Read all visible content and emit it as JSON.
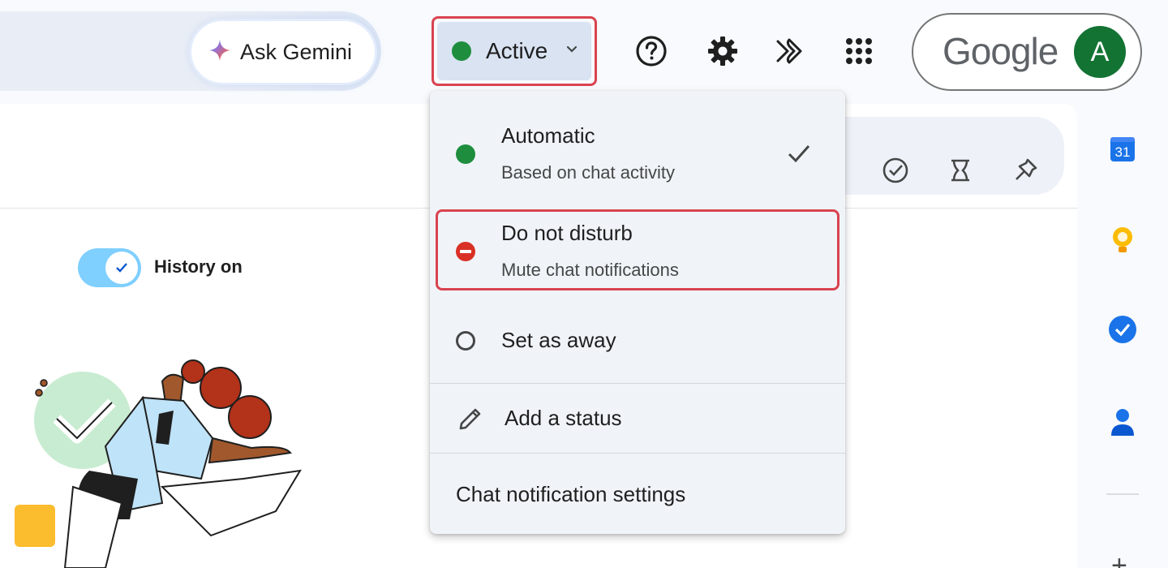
{
  "header": {
    "gemini_label": "Ask Gemini",
    "status_label": "Active",
    "status_color": "#1e8e3e",
    "icons": [
      "help-icon",
      "settings-gear-icon",
      "gemini-sparkle-icon",
      "apps-grid-icon"
    ],
    "brand": "Google",
    "avatar_letter": "A"
  },
  "toolbar": {
    "icons": [
      "task-check-icon",
      "snippet-icon",
      "pin-icon"
    ]
  },
  "history": {
    "label": "History on",
    "enabled": true
  },
  "status_menu": {
    "automatic": {
      "title": "Automatic",
      "subtitle": "Based on chat activity",
      "selected": true
    },
    "dnd": {
      "title": "Do not disturb",
      "subtitle": "Mute chat notifications"
    },
    "away": {
      "title": "Set as away"
    },
    "add_status": {
      "title": "Add a status"
    },
    "notif_settings": {
      "title": "Chat notification settings"
    }
  },
  "right_rail": {
    "calendar_day": "31",
    "icons": [
      "calendar-icon",
      "keep-icon",
      "tasks-icon",
      "contacts-icon",
      "add-icon"
    ]
  }
}
